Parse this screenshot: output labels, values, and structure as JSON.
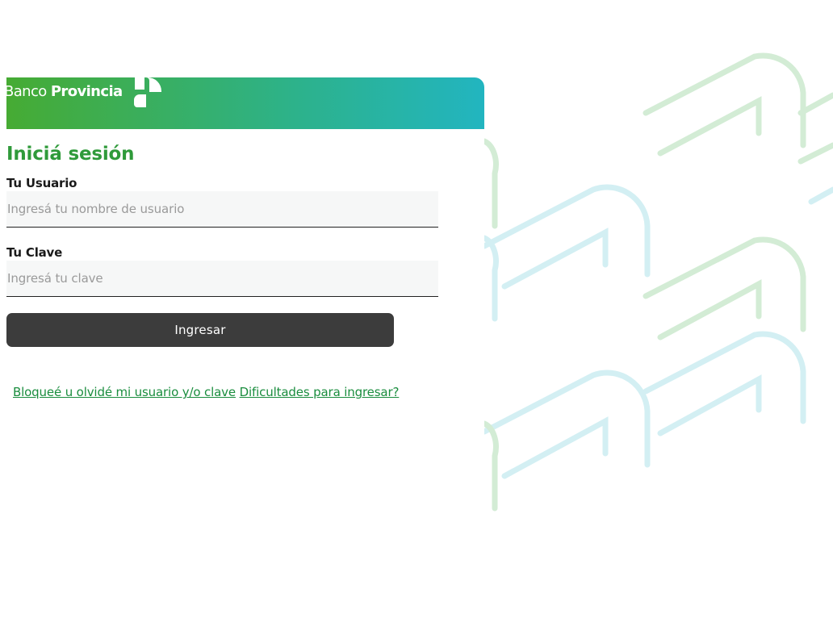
{
  "brand": {
    "name_regular": "Banco",
    "name_bold": "Provincia",
    "logo_icon": "banco-provincia-logo-icon"
  },
  "login": {
    "title": "Iniciá sesión",
    "username": {
      "label": "Tu Usuario",
      "placeholder": "Ingresá tu nombre de usuario",
      "value": ""
    },
    "password": {
      "label": "Tu Clave",
      "placeholder": "Ingresá tu clave",
      "value": ""
    },
    "submit_label": "Ingresar",
    "links": {
      "forgot": "Bloqueé u olvidé mi usuario y/o clave",
      "help": "Dificultades para ingresar?"
    }
  },
  "colors": {
    "title_green": "#2f9a3a",
    "link_green": "#1a8d3e",
    "button_dark": "#3c3c3c",
    "gradient_start": "#46ab33",
    "gradient_end": "#22b5c0",
    "pattern_green": "#cfe9cf",
    "pattern_cyan": "#cdeef2"
  }
}
